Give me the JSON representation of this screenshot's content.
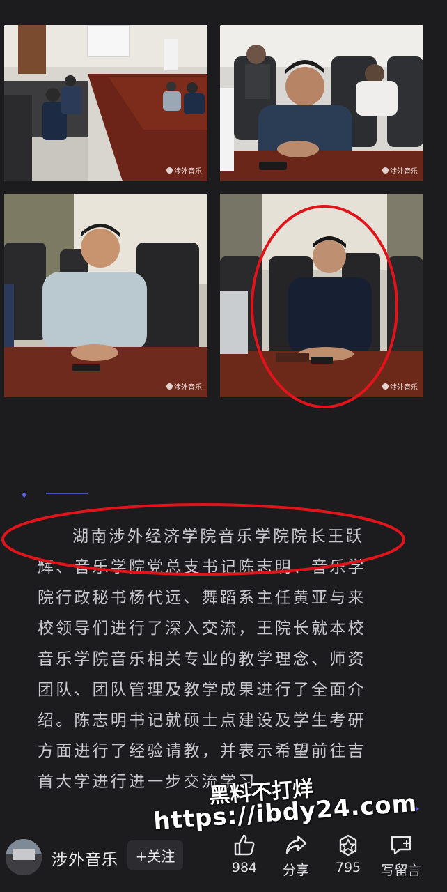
{
  "header": {
    "close_icon": "close-icon"
  },
  "photos": [
    {
      "watermark": "涉外音乐"
    },
    {
      "watermark": "涉外音乐"
    },
    {
      "watermark": "涉外音乐"
    },
    {
      "watermark": "涉外音乐"
    }
  ],
  "article": {
    "paragraph": "湖南涉外经济学院音乐学院院长王跃辉、音乐学院党总支书记陈志明、音乐学院行政秘书杨代远、舞蹈系主任黄亚与来校领导们进行了深入交流，王院长就本校音乐学院音乐相关专业的教学理念、师资团队、团队管理及教学成果进行了全面介绍。陈志明书记就硕士点建设及学生考研方面进行了经验请教，并表示希望前往吉首大学进行进一步交流学习。"
  },
  "overlay_watermark": {
    "line1": "黑料不打烊",
    "line2": "https://ibdy24.com"
  },
  "bottom_bar": {
    "account_name": "涉外音乐",
    "follow_label": "+关注",
    "like_count": "984",
    "share_label": "分享",
    "recommend_count": "795",
    "comment_label": "写留言"
  },
  "colors": {
    "background": "#1c1c1f",
    "accent": "#4b4fb8",
    "highlight": "#e0141b"
  }
}
